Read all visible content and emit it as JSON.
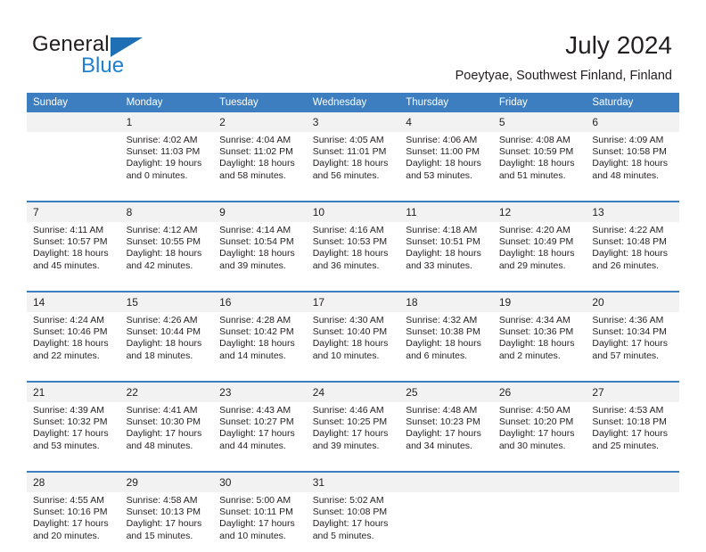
{
  "brand": {
    "word_general": "General",
    "word_blue": "Blue",
    "logo_icon": "triangle-flag-icon"
  },
  "header": {
    "title": "July 2024",
    "subtitle": "Poeytyae, Southwest Finland, Finland"
  },
  "theme": {
    "header_bg": "#3c7ebf",
    "header_text": "#ffffff",
    "daynum_bg": "#f2f2f2",
    "separator": "#3c7ebf",
    "brand_blue": "#1f7fd0",
    "text": "#231f20"
  },
  "weekdays": [
    "Sunday",
    "Monday",
    "Tuesday",
    "Wednesday",
    "Thursday",
    "Friday",
    "Saturday"
  ],
  "weeks": [
    {
      "days": [
        {
          "num": "",
          "l1": "",
          "l2": "",
          "l3": "",
          "l4": ""
        },
        {
          "num": "1",
          "l1": "Sunrise: 4:02 AM",
          "l2": "Sunset: 11:03 PM",
          "l3": "Daylight: 19 hours",
          "l4": "and 0 minutes."
        },
        {
          "num": "2",
          "l1": "Sunrise: 4:04 AM",
          "l2": "Sunset: 11:02 PM",
          "l3": "Daylight: 18 hours",
          "l4": "and 58 minutes."
        },
        {
          "num": "3",
          "l1": "Sunrise: 4:05 AM",
          "l2": "Sunset: 11:01 PM",
          "l3": "Daylight: 18 hours",
          "l4": "and 56 minutes."
        },
        {
          "num": "4",
          "l1": "Sunrise: 4:06 AM",
          "l2": "Sunset: 11:00 PM",
          "l3": "Daylight: 18 hours",
          "l4": "and 53 minutes."
        },
        {
          "num": "5",
          "l1": "Sunrise: 4:08 AM",
          "l2": "Sunset: 10:59 PM",
          "l3": "Daylight: 18 hours",
          "l4": "and 51 minutes."
        },
        {
          "num": "6",
          "l1": "Sunrise: 4:09 AM",
          "l2": "Sunset: 10:58 PM",
          "l3": "Daylight: 18 hours",
          "l4": "and 48 minutes."
        }
      ]
    },
    {
      "days": [
        {
          "num": "7",
          "l1": "Sunrise: 4:11 AM",
          "l2": "Sunset: 10:57 PM",
          "l3": "Daylight: 18 hours",
          "l4": "and 45 minutes."
        },
        {
          "num": "8",
          "l1": "Sunrise: 4:12 AM",
          "l2": "Sunset: 10:55 PM",
          "l3": "Daylight: 18 hours",
          "l4": "and 42 minutes."
        },
        {
          "num": "9",
          "l1": "Sunrise: 4:14 AM",
          "l2": "Sunset: 10:54 PM",
          "l3": "Daylight: 18 hours",
          "l4": "and 39 minutes."
        },
        {
          "num": "10",
          "l1": "Sunrise: 4:16 AM",
          "l2": "Sunset: 10:53 PM",
          "l3": "Daylight: 18 hours",
          "l4": "and 36 minutes."
        },
        {
          "num": "11",
          "l1": "Sunrise: 4:18 AM",
          "l2": "Sunset: 10:51 PM",
          "l3": "Daylight: 18 hours",
          "l4": "and 33 minutes."
        },
        {
          "num": "12",
          "l1": "Sunrise: 4:20 AM",
          "l2": "Sunset: 10:49 PM",
          "l3": "Daylight: 18 hours",
          "l4": "and 29 minutes."
        },
        {
          "num": "13",
          "l1": "Sunrise: 4:22 AM",
          "l2": "Sunset: 10:48 PM",
          "l3": "Daylight: 18 hours",
          "l4": "and 26 minutes."
        }
      ]
    },
    {
      "days": [
        {
          "num": "14",
          "l1": "Sunrise: 4:24 AM",
          "l2": "Sunset: 10:46 PM",
          "l3": "Daylight: 18 hours",
          "l4": "and 22 minutes."
        },
        {
          "num": "15",
          "l1": "Sunrise: 4:26 AM",
          "l2": "Sunset: 10:44 PM",
          "l3": "Daylight: 18 hours",
          "l4": "and 18 minutes."
        },
        {
          "num": "16",
          "l1": "Sunrise: 4:28 AM",
          "l2": "Sunset: 10:42 PM",
          "l3": "Daylight: 18 hours",
          "l4": "and 14 minutes."
        },
        {
          "num": "17",
          "l1": "Sunrise: 4:30 AM",
          "l2": "Sunset: 10:40 PM",
          "l3": "Daylight: 18 hours",
          "l4": "and 10 minutes."
        },
        {
          "num": "18",
          "l1": "Sunrise: 4:32 AM",
          "l2": "Sunset: 10:38 PM",
          "l3": "Daylight: 18 hours",
          "l4": "and 6 minutes."
        },
        {
          "num": "19",
          "l1": "Sunrise: 4:34 AM",
          "l2": "Sunset: 10:36 PM",
          "l3": "Daylight: 18 hours",
          "l4": "and 2 minutes."
        },
        {
          "num": "20",
          "l1": "Sunrise: 4:36 AM",
          "l2": "Sunset: 10:34 PM",
          "l3": "Daylight: 17 hours",
          "l4": "and 57 minutes."
        }
      ]
    },
    {
      "days": [
        {
          "num": "21",
          "l1": "Sunrise: 4:39 AM",
          "l2": "Sunset: 10:32 PM",
          "l3": "Daylight: 17 hours",
          "l4": "and 53 minutes."
        },
        {
          "num": "22",
          "l1": "Sunrise: 4:41 AM",
          "l2": "Sunset: 10:30 PM",
          "l3": "Daylight: 17 hours",
          "l4": "and 48 minutes."
        },
        {
          "num": "23",
          "l1": "Sunrise: 4:43 AM",
          "l2": "Sunset: 10:27 PM",
          "l3": "Daylight: 17 hours",
          "l4": "and 44 minutes."
        },
        {
          "num": "24",
          "l1": "Sunrise: 4:46 AM",
          "l2": "Sunset: 10:25 PM",
          "l3": "Daylight: 17 hours",
          "l4": "and 39 minutes."
        },
        {
          "num": "25",
          "l1": "Sunrise: 4:48 AM",
          "l2": "Sunset: 10:23 PM",
          "l3": "Daylight: 17 hours",
          "l4": "and 34 minutes."
        },
        {
          "num": "26",
          "l1": "Sunrise: 4:50 AM",
          "l2": "Sunset: 10:20 PM",
          "l3": "Daylight: 17 hours",
          "l4": "and 30 minutes."
        },
        {
          "num": "27",
          "l1": "Sunrise: 4:53 AM",
          "l2": "Sunset: 10:18 PM",
          "l3": "Daylight: 17 hours",
          "l4": "and 25 minutes."
        }
      ]
    },
    {
      "days": [
        {
          "num": "28",
          "l1": "Sunrise: 4:55 AM",
          "l2": "Sunset: 10:16 PM",
          "l3": "Daylight: 17 hours",
          "l4": "and 20 minutes."
        },
        {
          "num": "29",
          "l1": "Sunrise: 4:58 AM",
          "l2": "Sunset: 10:13 PM",
          "l3": "Daylight: 17 hours",
          "l4": "and 15 minutes."
        },
        {
          "num": "30",
          "l1": "Sunrise: 5:00 AM",
          "l2": "Sunset: 10:11 PM",
          "l3": "Daylight: 17 hours",
          "l4": "and 10 minutes."
        },
        {
          "num": "31",
          "l1": "Sunrise: 5:02 AM",
          "l2": "Sunset: 10:08 PM",
          "l3": "Daylight: 17 hours",
          "l4": "and 5 minutes."
        },
        {
          "num": "",
          "l1": "",
          "l2": "",
          "l3": "",
          "l4": ""
        },
        {
          "num": "",
          "l1": "",
          "l2": "",
          "l3": "",
          "l4": ""
        },
        {
          "num": "",
          "l1": "",
          "l2": "",
          "l3": "",
          "l4": ""
        }
      ]
    }
  ]
}
